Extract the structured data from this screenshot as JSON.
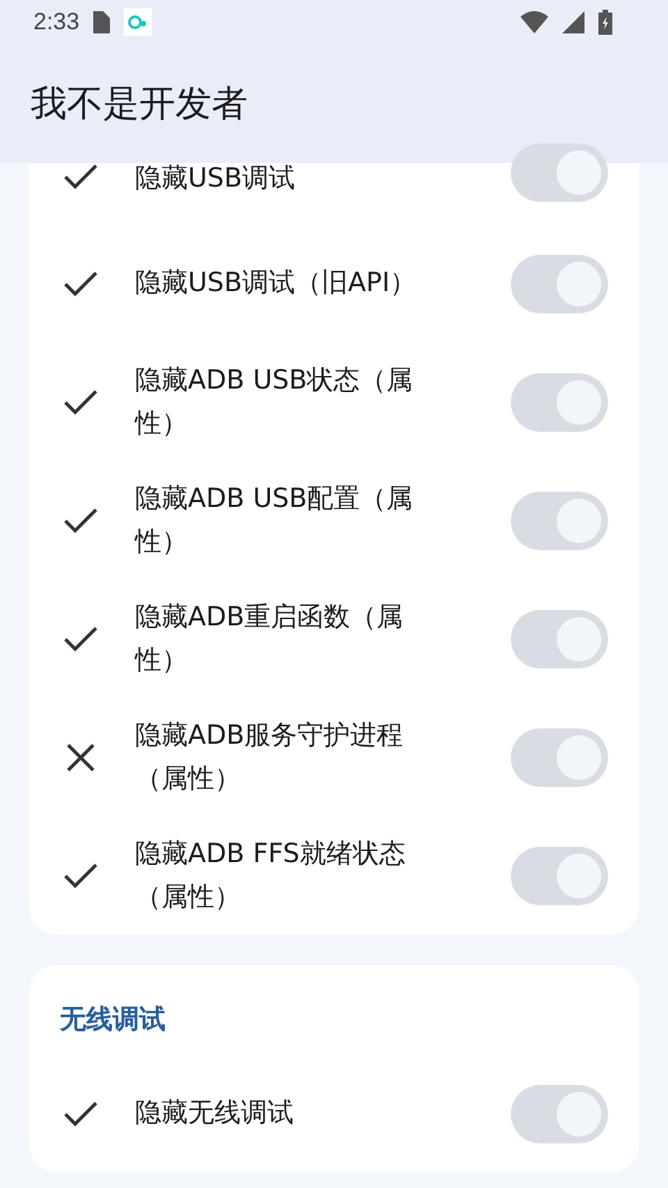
{
  "status_bar": {
    "time": "2:33"
  },
  "app_bar": {
    "title": "我不是开发者"
  },
  "sections": [
    {
      "items": [
        {
          "label": "隐藏USB调试",
          "kind": "check",
          "on": true
        },
        {
          "label": "隐藏USB调试（旧API）",
          "kind": "check",
          "on": true
        },
        {
          "label": "隐藏ADB USB状态（属性）",
          "kind": "check",
          "on": true
        },
        {
          "label": "隐藏ADB USB配置（属性）",
          "kind": "check",
          "on": true
        },
        {
          "label": "隐藏ADB重启函数（属性）",
          "kind": "check",
          "on": true
        },
        {
          "label": "隐藏ADB服务守护进程（属性）",
          "kind": "cross",
          "on": true
        },
        {
          "label": "隐藏ADB FFS就绪状态（属性）",
          "kind": "check",
          "on": true
        }
      ]
    },
    {
      "title": "无线调试",
      "items": [
        {
          "label": "隐藏无线调试",
          "kind": "check",
          "on": true
        }
      ]
    }
  ]
}
